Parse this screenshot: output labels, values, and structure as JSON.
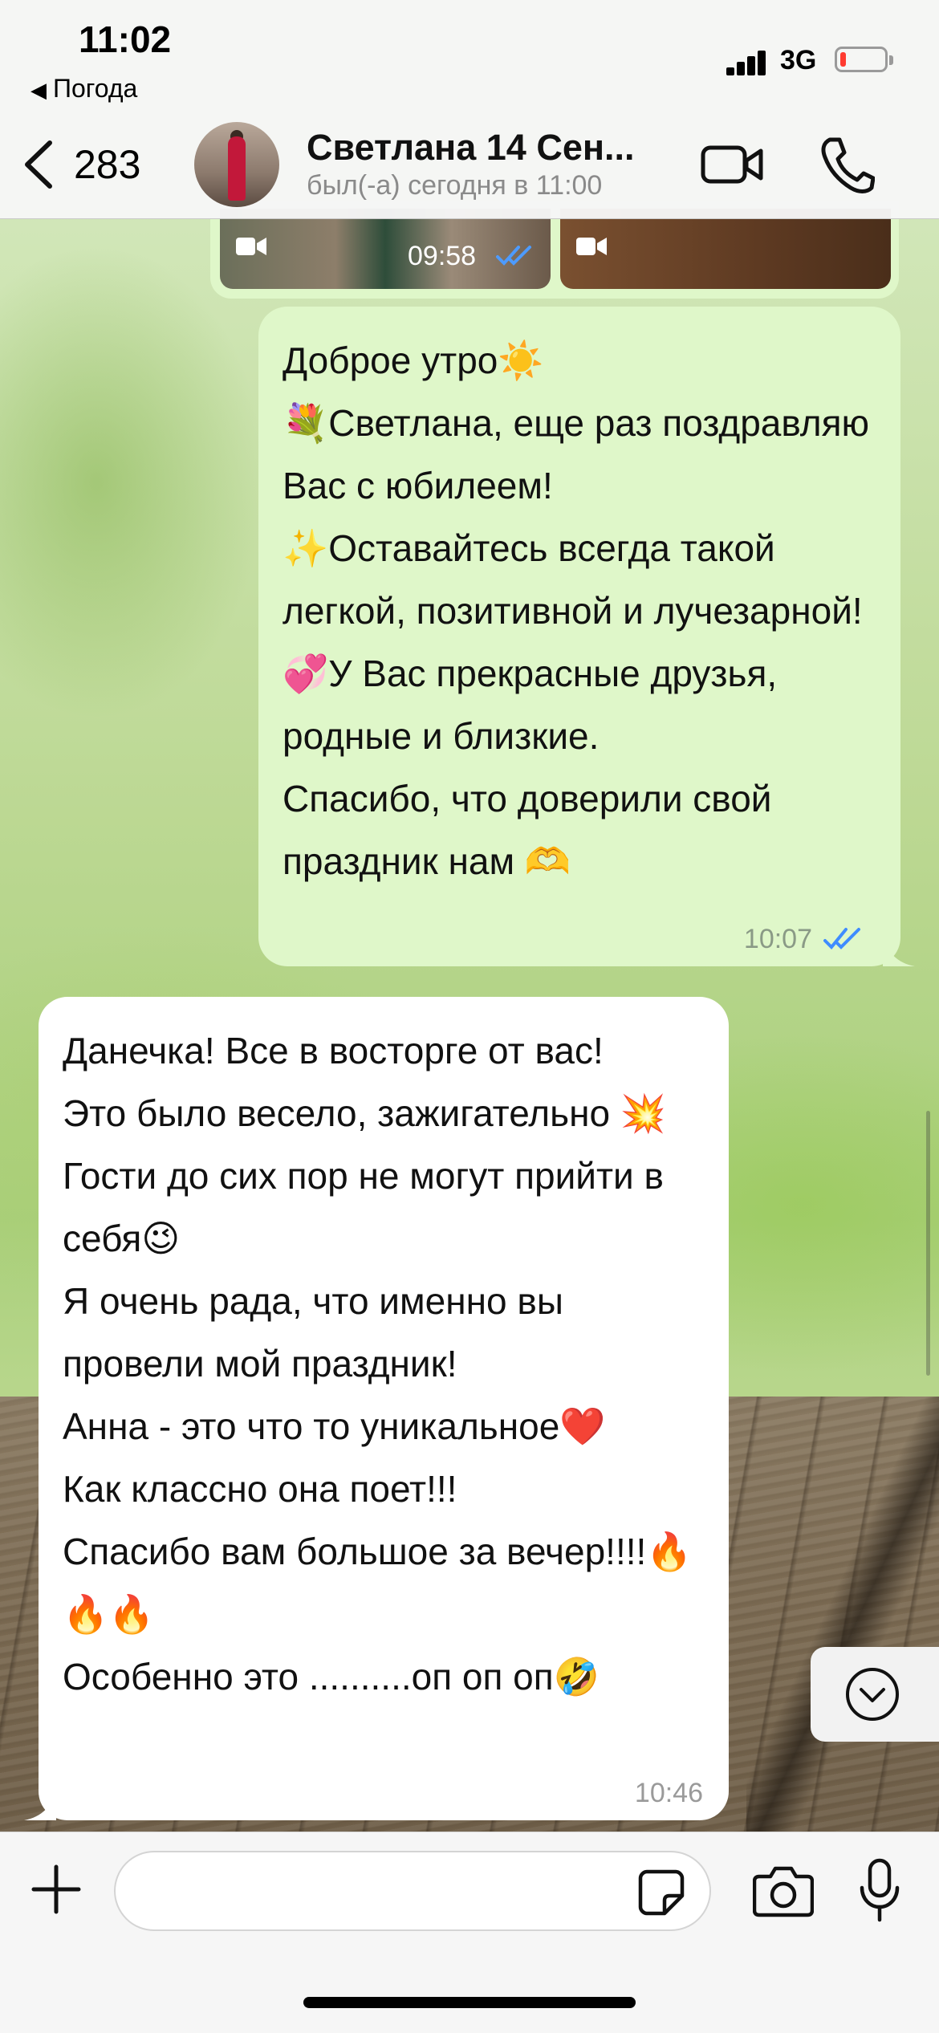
{
  "status_bar": {
    "time": "11:02",
    "back_app": "Погода",
    "network": "3G",
    "battery_level": 0.1,
    "battery_color": "#ff3b30"
  },
  "header": {
    "back_count": "283",
    "contact_name": "Светлана  14 Сен...",
    "contact_status": "был(-а) сегодня в 11:00",
    "icons": [
      "chevron-left-icon",
      "video-call-icon",
      "phone-icon"
    ]
  },
  "media_message": {
    "time": "09:58",
    "status": "read",
    "icons": [
      "video-camera-icon",
      "video-camera-icon"
    ]
  },
  "messages": [
    {
      "direction": "outgoing",
      "text": "Доброе утро☀️\n💐Светлана, еще раз поздравляю Вас с юбилеем!\n✨Оставайтесь всегда такой легкой, позитивной и лучезарной!\n💞У Вас прекрасные друзья, родные и близкие.\nСпасибо, что доверили свой праздник нам 🫶",
      "time": "10:07",
      "status": "read"
    },
    {
      "direction": "incoming",
      "text": "Данечка! Все в восторге от вас!\nЭто было весело, зажигательно 💥\nГости до сих пор не могут прийти в себя😉\nЯ очень рада, что именно вы провели мой праздник!\nАнна - это что то уникальное❤️\nКак классно она поет!!!\nСпасибо вам большое за вечер!!!!🔥🔥🔥\nОсобенно это ..........оп оп оп🤣",
      "time": "10:46"
    }
  ],
  "input_bar": {
    "placeholder": "",
    "icons": [
      "plus-icon",
      "sticker-icon",
      "camera-icon",
      "microphone-icon"
    ]
  },
  "colors": {
    "outgoing_bubble": "#dff7c9",
    "incoming_bubble": "#ffffff",
    "read_ticks": "#3f8cff",
    "header_bg": "#f6f6f6"
  }
}
